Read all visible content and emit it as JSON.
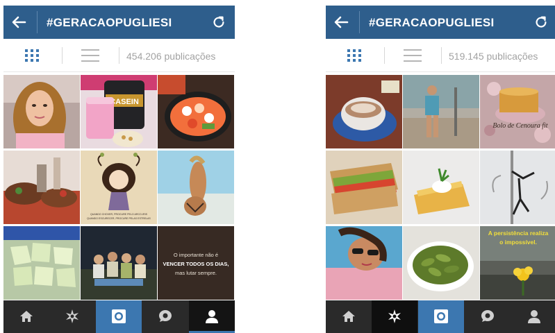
{
  "screens": [
    {
      "title": "#GERACAOPUGLIESI",
      "post_count": "454.206 publicações",
      "photos": {
        "tile8_line1": "O importante não é",
        "tile8_line2": "VENCER TODOS OS DIAS,",
        "tile8_line3": "mas lutar sempre.",
        "tile5_line1": "QUANDO CHOVER, PROCURE PELO ARCO-IRIS",
        "tile5_line2": "QUANDO ESCURECER, PROCURE PELAS ESTRELAS",
        "tile2_label": "CASEIN"
      },
      "nav": [
        "home",
        "explore",
        "camera",
        "activity",
        "profile"
      ],
      "selected_nav": "profile"
    },
    {
      "title": "#GERACAOPUGLIESI",
      "post_count": "519.145 publicações",
      "photos": {
        "tile3_line1": "Bolo de Cenoura fit",
        "tile8_line1": "A persistência realiza",
        "tile8_line2": "o impossível."
      },
      "nav": [
        "home",
        "explore",
        "camera",
        "activity",
        "profile"
      ],
      "selected_nav": "explore"
    }
  ],
  "colors": {
    "header": "#2e5e8c",
    "accent": "#3c77b0",
    "navbar": "#2a2a2a"
  }
}
